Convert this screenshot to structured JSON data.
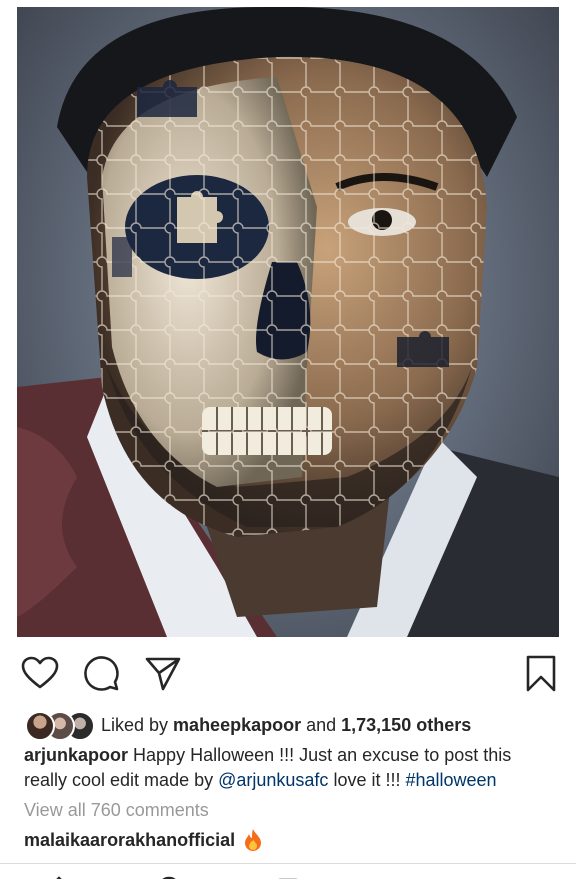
{
  "post": {
    "image_icon": "skull-puzzle-portrait",
    "liked_by_prefix": "Liked by ",
    "liked_by_user": "maheepkapoor",
    "liked_by_and": " and ",
    "liked_by_count": "1,73,150 others",
    "caption_user": "arjunkapoor",
    "caption_text_1": " Happy Halloween !!! Just an excuse to post this really cool edit made by ",
    "caption_mention": "@arjunkusafc",
    "caption_text_2": " love it !!! ",
    "caption_hashtag": "#halloween",
    "view_all_comments": "View all 760 comments",
    "comment_user": "malaikaarorakhanofficial",
    "comment_emoji_icon": "fire-icon"
  },
  "actions": {
    "like_icon": "heart-icon",
    "comment_icon": "comment-bubble-icon",
    "share_icon": "paper-plane-icon",
    "save_icon": "bookmark-icon"
  },
  "colors": {
    "text": "#262626",
    "link": "#003569",
    "muted": "#999999",
    "divider": "#dbdbdb"
  }
}
